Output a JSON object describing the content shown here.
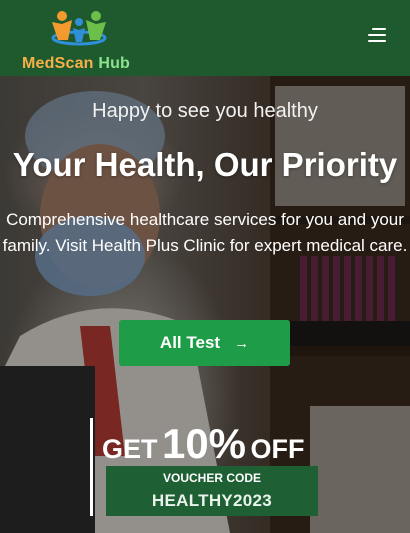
{
  "brand": {
    "name_part1": "MedScan",
    "name_part2": "Hub",
    "logo_icon": "people-family-icon",
    "colors": {
      "part1": "#f5b04a",
      "part2": "#8be38e",
      "nav_bg": "#1f5a2e"
    }
  },
  "nav": {
    "menu_icon": "hamburger-menu-icon"
  },
  "hero": {
    "tagline": "Happy to see you healthy",
    "headline": "Your Health, Our Priority",
    "description": "Comprehensive healthcare services for you and your family. Visit Health Plus Clinic for expert medical care.",
    "cta_label": "All Test",
    "cta_icon": "arrow-right-icon",
    "cta_color": "#1e9c47"
  },
  "promo": {
    "get": "GET",
    "percent": "10%",
    "off": "OFF",
    "voucher_label": "VOUCHER CODE",
    "voucher_code": "HEALTHY2023",
    "voucher_bg": "#1f5f34"
  }
}
